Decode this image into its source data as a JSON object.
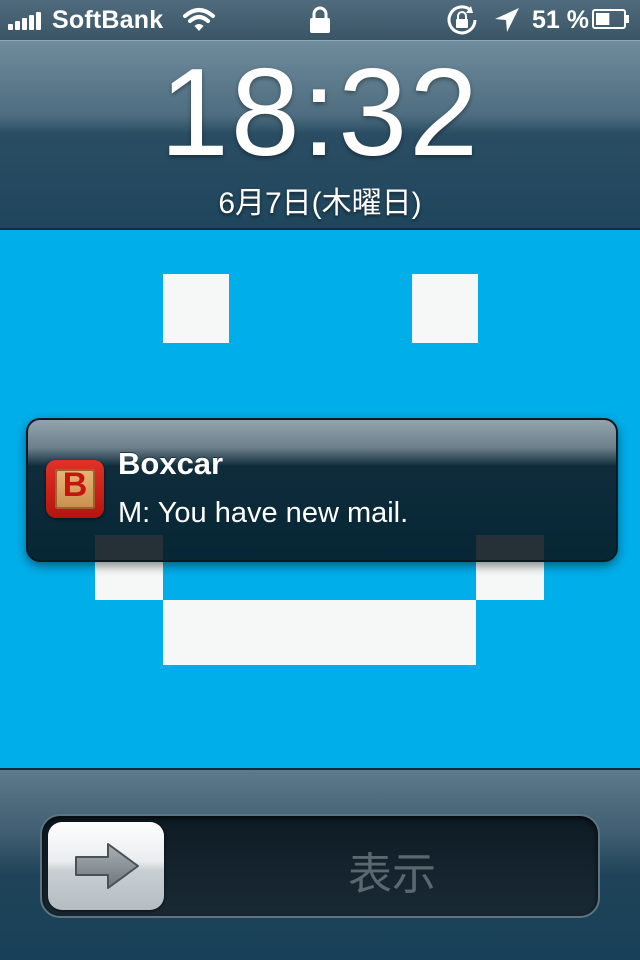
{
  "status_bar": {
    "carrier": "SoftBank",
    "battery_percent": "51 %",
    "battery_level": 0.51,
    "icons": [
      "signal-bars-icon",
      "wifi-icon",
      "lock-icon",
      "rotation-lock-icon",
      "location-arrow-icon",
      "battery-icon"
    ]
  },
  "lock_screen": {
    "time": "18:32",
    "date": "6月7日(木曜日)"
  },
  "notification": {
    "app_icon": "boxcar-app-icon",
    "icon_letter": "B",
    "title": "Boxcar",
    "message": "M: You have new mail."
  },
  "slider": {
    "label": "表示",
    "knob_icon": "right-arrow-icon"
  },
  "colors": {
    "wallpaper": "#00aeea",
    "wallpaper_face": "#f5f8f7"
  }
}
